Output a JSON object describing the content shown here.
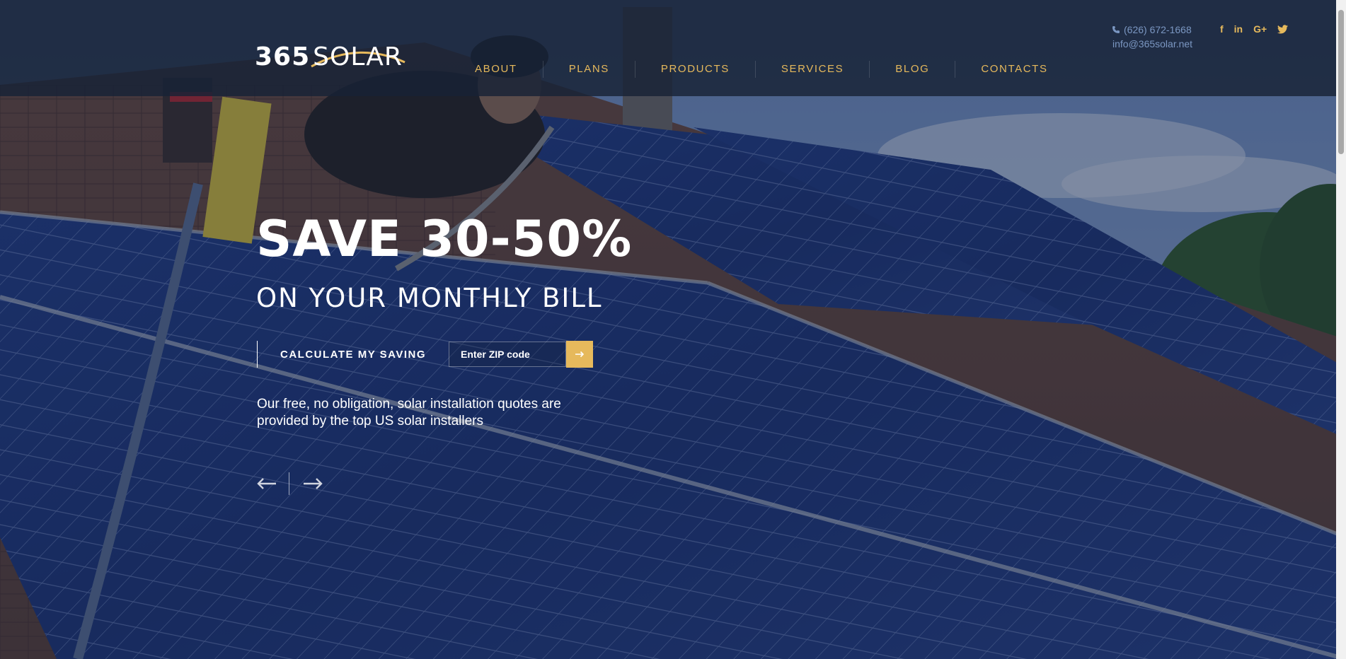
{
  "header": {
    "logo": {
      "number": "365",
      "word": "SOLAR"
    },
    "nav": [
      {
        "label": "ABOUT"
      },
      {
        "label": "PLANS"
      },
      {
        "label": "PRODUCTS"
      },
      {
        "label": "SERVICES"
      },
      {
        "label": "BLOG"
      },
      {
        "label": "CONTACTS"
      }
    ],
    "contact": {
      "phone": "(626) 672-1668",
      "email": "info@365solar.net"
    },
    "social": [
      {
        "icon": "facebook-icon",
        "glyph": "f"
      },
      {
        "icon": "linkedin-icon",
        "glyph": "in"
      },
      {
        "icon": "google-plus-icon",
        "glyph": "G+"
      },
      {
        "icon": "twitter-icon",
        "glyph": "twitter-bird"
      }
    ]
  },
  "hero": {
    "title": "SAVE 30-50%",
    "subtitle": "ON YOUR MONTHLY BILL",
    "calc_label": "CALCULATE MY SAVING",
    "zip_placeholder": "Enter ZIP code",
    "description": "Our free, no obligation, solar installation quotes are provided by the top US solar installers"
  },
  "colors": {
    "accent": "#e6b95c",
    "header_bg": "#172236",
    "contact_text": "#7b97c2"
  }
}
